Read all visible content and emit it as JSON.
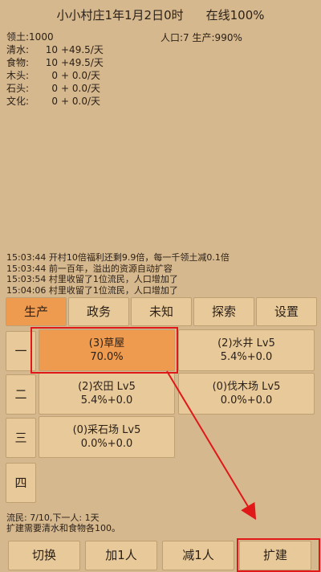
{
  "header": {
    "village": "小小村庄1年1月2日0时",
    "online": "在线100%"
  },
  "stats": {
    "territory": "领土:1000",
    "population": "人口:7",
    "production": "生产:990%",
    "resources": [
      {
        "label": "清水:",
        "amount": "10",
        "rate": "+49.5/天"
      },
      {
        "label": "食物:",
        "amount": "10",
        "rate": "+49.5/天"
      },
      {
        "label": "木头:",
        "amount": "0",
        "rate": "+ 0.0/天"
      },
      {
        "label": "石头:",
        "amount": "0",
        "rate": "+ 0.0/天"
      },
      {
        "label": "文化:",
        "amount": "0",
        "rate": "+ 0.0/天"
      }
    ]
  },
  "log": [
    "15:03:44 开村10倍福利还剩9.9倍，每一千领土减0.1倍",
    "15:03:44 前一百年，溢出的资源自动扩容",
    "15:03:54 村里收留了1位流民，人口增加了",
    "15:04:06 村里收留了1位流民，人口增加了"
  ],
  "tabs": [
    "生产",
    "政务",
    "未知",
    "探索",
    "设置"
  ],
  "tiers": [
    "一",
    "二",
    "三",
    "四"
  ],
  "buildings": [
    {
      "name": "(3)草屋",
      "value": "70.0%"
    },
    {
      "name": "(2)水井 Lv5",
      "value": "5.4%+0.0"
    },
    {
      "name": "(2)农田 Lv5",
      "value": "5.4%+0.0"
    },
    {
      "name": "(0)伐木场 Lv5",
      "value": "0.0%+0.0"
    },
    {
      "name": "(0)采石场 Lv5",
      "value": "0.0%+0.0"
    }
  ],
  "status": {
    "refugees": "流民: 7/10,下一人: 1天",
    "expand_note": "扩建需要清水和食物各100。"
  },
  "actions": {
    "switch": "切换",
    "add": "加1人",
    "remove": "减1人",
    "expand": "扩建"
  },
  "colors": {
    "background": "#d6b88e",
    "button": "#e8c999",
    "selected": "#ee9b4f",
    "highlight": "#e01818"
  }
}
